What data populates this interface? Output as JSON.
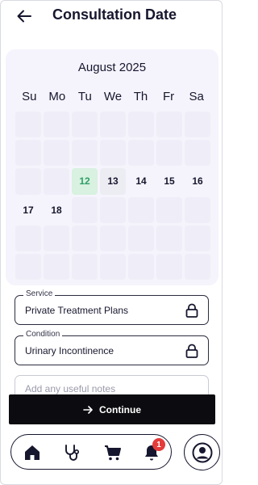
{
  "header": {
    "title": "Consultation Date"
  },
  "calendar": {
    "month": "August 2025",
    "weekdays": [
      "Su",
      "Mo",
      "Tu",
      "We",
      "Th",
      "Fr",
      "Sa"
    ],
    "days": {
      "d12": "12",
      "d13": "13",
      "d14": "14",
      "d15": "15",
      "d16": "16",
      "d17": "17",
      "d18": "18"
    },
    "highlight_color": "#d8f1e0"
  },
  "service": {
    "label": "Service",
    "value": "Private Treatment Plans"
  },
  "condition": {
    "label": "Condition",
    "value": "Urinary Incontinence"
  },
  "notes": {
    "placeholder": "Add any useful notes"
  },
  "continue": {
    "label": "Continue"
  },
  "nav": {
    "notifications_badge": "1",
    "icons": [
      "home-icon",
      "stethoscope-icon",
      "cart-icon",
      "bell-icon",
      "profile-icon"
    ]
  },
  "colors": {
    "primary": "#0c0c10",
    "accent_green": "#2f9e67",
    "badge": "#e43b3b"
  }
}
